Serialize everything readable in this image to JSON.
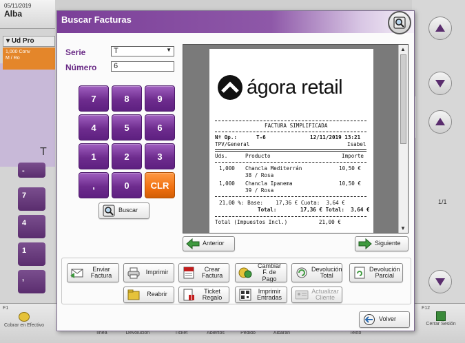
{
  "background": {
    "date": "05/11/2019",
    "user": "Alba",
    "list_header": "Ud Pro",
    "list_row_line1": "1,000 Conv",
    "list_row_line2": "M / Ro",
    "table_letter": "T",
    "page_indicator": "1/1",
    "bottom_buttons": [
      "Cobrar en Efectivo",
      "línea",
      "Devolución",
      "Ticket",
      "Abiertos",
      "Pedido",
      "Albarán",
      "Texto",
      "Cerrar Sesión"
    ],
    "bottom_fkeys": [
      "F1",
      "F12"
    ],
    "left_keys": [
      "7",
      "4",
      "1",
      ","
    ]
  },
  "dialog": {
    "title": "Buscar Facturas",
    "serie_label": "Serie",
    "serie_value": "T",
    "numero_label": "Número",
    "numero_value": "6",
    "keypad": [
      "7",
      "8",
      "9",
      "4",
      "5",
      "6",
      "1",
      "2",
      "3",
      ",",
      "0",
      "CLR"
    ],
    "search_button": "Buscar",
    "prev_button": "Anterior",
    "next_button": "Siguiente",
    "actions": {
      "send_invoice": "Enviar Factura",
      "print": "Imprimir",
      "create_invoice": "Crear Factura",
      "change_payment": "Cambiar F. de Pago",
      "return_total": "Devolución Total",
      "return_partial": "Devolución Parcial",
      "reopen": "Reabrir",
      "gift_ticket": "Ticket Regalo",
      "print_entries": "Imprimir Entradas",
      "update_client": "Actualizar Cliente"
    },
    "back_button": "Volver"
  },
  "receipt": {
    "logo_text": "ágora retail",
    "doc_type": "FACTURA SIMPLIFICADA",
    "op_label": "Nº Op.:",
    "op_value": "T-6",
    "datetime": "12/11/2019 13:21",
    "terminal": "TPV/General",
    "cashier": "Isabel",
    "col_units": "Uds.",
    "col_product": "Producto",
    "col_amount": "Importe",
    "items": [
      {
        "qty": "1,000",
        "name": "Chancla Mediterrán",
        "variant": "38 / Rosa",
        "amount": "10,50 €"
      },
      {
        "qty": "1,000",
        "name": "Chancla Ipanema",
        "variant": "39 / Rosa",
        "amount": "10,50 €"
      }
    ],
    "tax_line": "21,00 %: Base:    17,36 € Cuota:  3,64 €",
    "total_label": "Total:",
    "total_value": "17,36 € Total:  3,64 €",
    "footer_line": "Total (Impuestos Incl.)          21,00 €"
  }
}
